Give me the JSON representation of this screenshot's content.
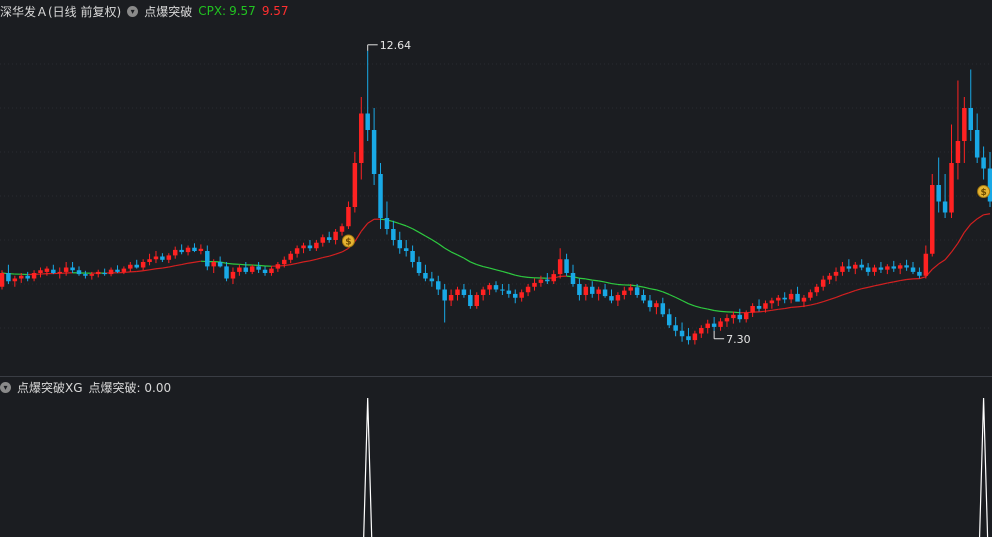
{
  "header": {
    "stock_name": "深华发Ａ(日线 前复权)",
    "indicator_name": "点爆突破",
    "cpx_label": "CPX:",
    "cpx_value_green": "9.57",
    "cpx_value_red": "9.57",
    "dropdown_icon": "chevron-down-icon"
  },
  "sub_header": {
    "label": "点爆突破XG",
    "value_label": "点爆突破: 0.00",
    "dropdown_icon": "chevron-down-icon"
  },
  "colors": {
    "background": "#1b1d21",
    "up": "#ff2222",
    "down": "#19a9e6",
    "ma_up": "#d42020",
    "ma_down": "#2ecc40",
    "signal": "#ffffff",
    "grid": "#2a2c31"
  },
  "chart_data": [
    {
      "type": "candlestick",
      "ylim": [
        7.0,
        13.0
      ],
      "annotations": [
        {
          "label": "12.64",
          "kind": "high",
          "index": 57
        },
        {
          "label": "7.30",
          "kind": "low",
          "index": 111
        }
      ],
      "signal_markers": [
        {
          "index": 54,
          "icon": "money-bag-icon"
        },
        {
          "index": 153,
          "icon": "money-bag-icon"
        }
      ],
      "candles": [
        [
          8.35,
          8.65,
          8.3,
          8.6
        ],
        [
          8.6,
          8.75,
          8.4,
          8.45
        ],
        [
          8.45,
          8.55,
          8.35,
          8.5
        ],
        [
          8.5,
          8.6,
          8.42,
          8.55
        ],
        [
          8.55,
          8.62,
          8.45,
          8.5
        ],
        [
          8.5,
          8.65,
          8.45,
          8.6
        ],
        [
          8.6,
          8.7,
          8.52,
          8.65
        ],
        [
          8.62,
          8.72,
          8.55,
          8.68
        ],
        [
          8.66,
          8.75,
          8.58,
          8.6
        ],
        [
          8.6,
          8.7,
          8.5,
          8.62
        ],
        [
          8.62,
          8.8,
          8.55,
          8.7
        ],
        [
          8.7,
          8.8,
          8.6,
          8.65
        ],
        [
          8.65,
          8.72,
          8.55,
          8.58
        ],
        [
          8.58,
          8.64,
          8.5,
          8.55
        ],
        [
          8.55,
          8.62,
          8.48,
          8.58
        ],
        [
          8.58,
          8.66,
          8.52,
          8.62
        ],
        [
          8.6,
          8.68,
          8.55,
          8.58
        ],
        [
          8.58,
          8.7,
          8.54,
          8.66
        ],
        [
          8.66,
          8.74,
          8.6,
          8.62
        ],
        [
          8.62,
          8.72,
          8.58,
          8.68
        ],
        [
          8.68,
          8.8,
          8.62,
          8.75
        ],
        [
          8.75,
          8.84,
          8.68,
          8.7
        ],
        [
          8.7,
          8.85,
          8.65,
          8.8
        ],
        [
          8.8,
          8.95,
          8.74,
          8.85
        ],
        [
          8.85,
          9.0,
          8.78,
          8.9
        ],
        [
          8.9,
          8.96,
          8.8,
          8.84
        ],
        [
          8.84,
          8.96,
          8.78,
          8.92
        ],
        [
          8.92,
          9.08,
          8.86,
          9.02
        ],
        [
          9.02,
          9.12,
          8.94,
          8.98
        ],
        [
          8.98,
          9.1,
          8.92,
          9.06
        ],
        [
          9.06,
          9.14,
          8.98,
          9.0
        ],
        [
          9.0,
          9.12,
          8.94,
          9.04
        ],
        [
          9.0,
          9.1,
          8.65,
          8.72
        ],
        [
          8.72,
          8.85,
          8.6,
          8.8
        ],
        [
          8.8,
          8.9,
          8.7,
          8.72
        ],
        [
          8.72,
          8.8,
          8.45,
          8.5
        ],
        [
          8.5,
          8.7,
          8.4,
          8.62
        ],
        [
          8.62,
          8.75,
          8.55,
          8.7
        ],
        [
          8.7,
          8.8,
          8.58,
          8.62
        ],
        [
          8.62,
          8.75,
          8.58,
          8.72
        ],
        [
          8.72,
          8.8,
          8.6,
          8.66
        ],
        [
          8.66,
          8.72,
          8.55,
          8.6
        ],
        [
          8.6,
          8.72,
          8.55,
          8.68
        ],
        [
          8.68,
          8.8,
          8.62,
          8.76
        ],
        [
          8.76,
          8.9,
          8.7,
          8.84
        ],
        [
          8.84,
          9.0,
          8.78,
          8.95
        ],
        [
          8.95,
          9.1,
          8.88,
          9.05
        ],
        [
          9.05,
          9.15,
          8.96,
          9.1
        ],
        [
          9.1,
          9.2,
          9.0,
          9.05
        ],
        [
          9.05,
          9.2,
          9.0,
          9.15
        ],
        [
          9.15,
          9.3,
          9.08,
          9.25
        ],
        [
          9.25,
          9.35,
          9.15,
          9.2
        ],
        [
          9.2,
          9.4,
          9.12,
          9.35
        ],
        [
          9.35,
          9.5,
          9.28,
          9.45
        ],
        [
          9.45,
          9.9,
          9.4,
          9.8
        ],
        [
          9.8,
          10.8,
          9.7,
          10.6
        ],
        [
          10.6,
          11.8,
          10.3,
          11.5
        ],
        [
          11.5,
          12.64,
          11.0,
          11.2
        ],
        [
          11.2,
          11.6,
          10.2,
          10.4
        ],
        [
          10.4,
          10.6,
          9.4,
          9.6
        ],
        [
          9.6,
          9.9,
          9.3,
          9.4
        ],
        [
          9.4,
          9.55,
          9.1,
          9.2
        ],
        [
          9.2,
          9.35,
          8.95,
          9.05
        ],
        [
          9.05,
          9.2,
          8.9,
          9.0
        ],
        [
          9.0,
          9.1,
          8.7,
          8.8
        ],
        [
          8.8,
          8.9,
          8.55,
          8.6
        ],
        [
          8.6,
          8.75,
          8.45,
          8.5
        ],
        [
          8.5,
          8.62,
          8.35,
          8.45
        ],
        [
          8.45,
          8.55,
          8.2,
          8.3
        ],
        [
          8.3,
          8.4,
          7.7,
          8.1
        ],
        [
          8.1,
          8.3,
          8.0,
          8.2
        ],
        [
          8.2,
          8.35,
          8.1,
          8.3
        ],
        [
          8.3,
          8.4,
          8.15,
          8.2
        ],
        [
          8.2,
          8.3,
          7.95,
          8.0
        ],
        [
          8.0,
          8.25,
          7.95,
          8.2
        ],
        [
          8.2,
          8.35,
          8.1,
          8.3
        ],
        [
          8.3,
          8.42,
          8.2,
          8.38
        ],
        [
          8.38,
          8.45,
          8.25,
          8.3
        ],
        [
          8.3,
          8.4,
          8.2,
          8.28
        ],
        [
          8.28,
          8.4,
          8.15,
          8.22
        ],
        [
          8.22,
          8.3,
          8.05,
          8.15
        ],
        [
          8.15,
          8.3,
          8.08,
          8.25
        ],
        [
          8.25,
          8.4,
          8.18,
          8.35
        ],
        [
          8.35,
          8.5,
          8.28,
          8.42
        ],
        [
          8.42,
          8.55,
          8.35,
          8.48
        ],
        [
          8.48,
          8.6,
          8.4,
          8.45
        ],
        [
          8.45,
          8.65,
          8.4,
          8.58
        ],
        [
          8.58,
          9.05,
          8.5,
          8.85
        ],
        [
          8.85,
          8.95,
          8.55,
          8.6
        ],
        [
          8.6,
          8.75,
          8.35,
          8.4
        ],
        [
          8.4,
          8.5,
          8.1,
          8.2
        ],
        [
          8.2,
          8.4,
          8.1,
          8.35
        ],
        [
          8.35,
          8.45,
          8.15,
          8.22
        ],
        [
          8.22,
          8.35,
          8.1,
          8.3
        ],
        [
          8.3,
          8.4,
          8.15,
          8.18
        ],
        [
          8.18,
          8.3,
          8.05,
          8.1
        ],
        [
          8.1,
          8.25,
          8.0,
          8.2
        ],
        [
          8.2,
          8.35,
          8.12,
          8.28
        ],
        [
          8.28,
          8.4,
          8.2,
          8.34
        ],
        [
          8.34,
          8.4,
          8.15,
          8.2
        ],
        [
          8.2,
          8.3,
          8.05,
          8.1
        ],
        [
          8.1,
          8.2,
          7.9,
          7.98
        ],
        [
          7.98,
          8.1,
          7.85,
          8.05
        ],
        [
          8.05,
          8.15,
          7.8,
          7.85
        ],
        [
          7.85,
          7.95,
          7.6,
          7.65
        ],
        [
          7.65,
          7.8,
          7.45,
          7.55
        ],
        [
          7.55,
          7.7,
          7.35,
          7.45
        ],
        [
          7.45,
          7.6,
          7.3,
          7.38
        ],
        [
          7.38,
          7.55,
          7.3,
          7.5
        ],
        [
          7.5,
          7.65,
          7.42,
          7.6
        ],
        [
          7.6,
          7.75,
          7.5,
          7.68
        ],
        [
          7.68,
          7.8,
          7.55,
          7.62
        ],
        [
          7.62,
          7.78,
          7.55,
          7.72
        ],
        [
          7.72,
          7.85,
          7.62,
          7.78
        ],
        [
          7.78,
          7.9,
          7.68,
          7.84
        ],
        [
          7.84,
          7.95,
          7.7,
          7.76
        ],
        [
          7.76,
          7.92,
          7.7,
          7.88
        ],
        [
          7.88,
          8.05,
          7.8,
          8.0
        ],
        [
          8.0,
          8.12,
          7.9,
          7.95
        ],
        [
          7.95,
          8.1,
          7.88,
          8.05
        ],
        [
          8.05,
          8.15,
          7.95,
          8.1
        ],
        [
          8.1,
          8.2,
          8.0,
          8.15
        ],
        [
          8.15,
          8.25,
          8.05,
          8.12
        ],
        [
          8.12,
          8.3,
          8.05,
          8.22
        ],
        [
          8.22,
          8.35,
          8.15,
          8.08
        ],
        [
          8.08,
          8.2,
          7.98,
          8.15
        ],
        [
          8.15,
          8.3,
          8.1,
          8.25
        ],
        [
          8.25,
          8.4,
          8.18,
          8.35
        ],
        [
          8.35,
          8.55,
          8.28,
          8.48
        ],
        [
          8.48,
          8.6,
          8.4,
          8.55
        ],
        [
          8.55,
          8.7,
          8.45,
          8.62
        ],
        [
          8.62,
          8.8,
          8.55,
          8.72
        ],
        [
          8.72,
          8.85,
          8.62,
          8.68
        ],
        [
          8.68,
          8.8,
          8.58,
          8.75
        ],
        [
          8.75,
          8.85,
          8.65,
          8.7
        ],
        [
          8.7,
          8.78,
          8.55,
          8.62
        ],
        [
          8.62,
          8.75,
          8.55,
          8.7
        ],
        [
          8.7,
          8.8,
          8.6,
          8.66
        ],
        [
          8.66,
          8.76,
          8.58,
          8.72
        ],
        [
          8.72,
          8.82,
          8.62,
          8.68
        ],
        [
          8.68,
          8.78,
          8.58,
          8.74
        ],
        [
          8.74,
          8.84,
          8.64,
          8.7
        ],
        [
          8.7,
          8.8,
          8.58,
          8.62
        ],
        [
          8.62,
          8.7,
          8.5,
          8.55
        ],
        [
          8.55,
          9.1,
          8.5,
          8.95
        ],
        [
          8.95,
          10.4,
          8.9,
          10.2
        ],
        [
          10.2,
          10.7,
          9.7,
          9.9
        ],
        [
          9.9,
          10.4,
          9.6,
          9.7
        ],
        [
          9.7,
          11.3,
          9.6,
          10.6
        ],
        [
          10.6,
          12.1,
          10.3,
          11.0
        ],
        [
          11.0,
          11.8,
          10.6,
          11.6
        ],
        [
          11.6,
          12.3,
          11.0,
          11.2
        ],
        [
          11.2,
          11.5,
          10.6,
          10.7
        ],
        [
          10.7,
          10.9,
          10.3,
          10.5
        ],
        [
          10.5,
          10.8,
          9.8,
          9.9
        ]
      ]
    },
    {
      "type": "line",
      "ylim": [
        0,
        1
      ],
      "values_by_index": {
        "57": 1,
        "153": 1
      }
    }
  ]
}
